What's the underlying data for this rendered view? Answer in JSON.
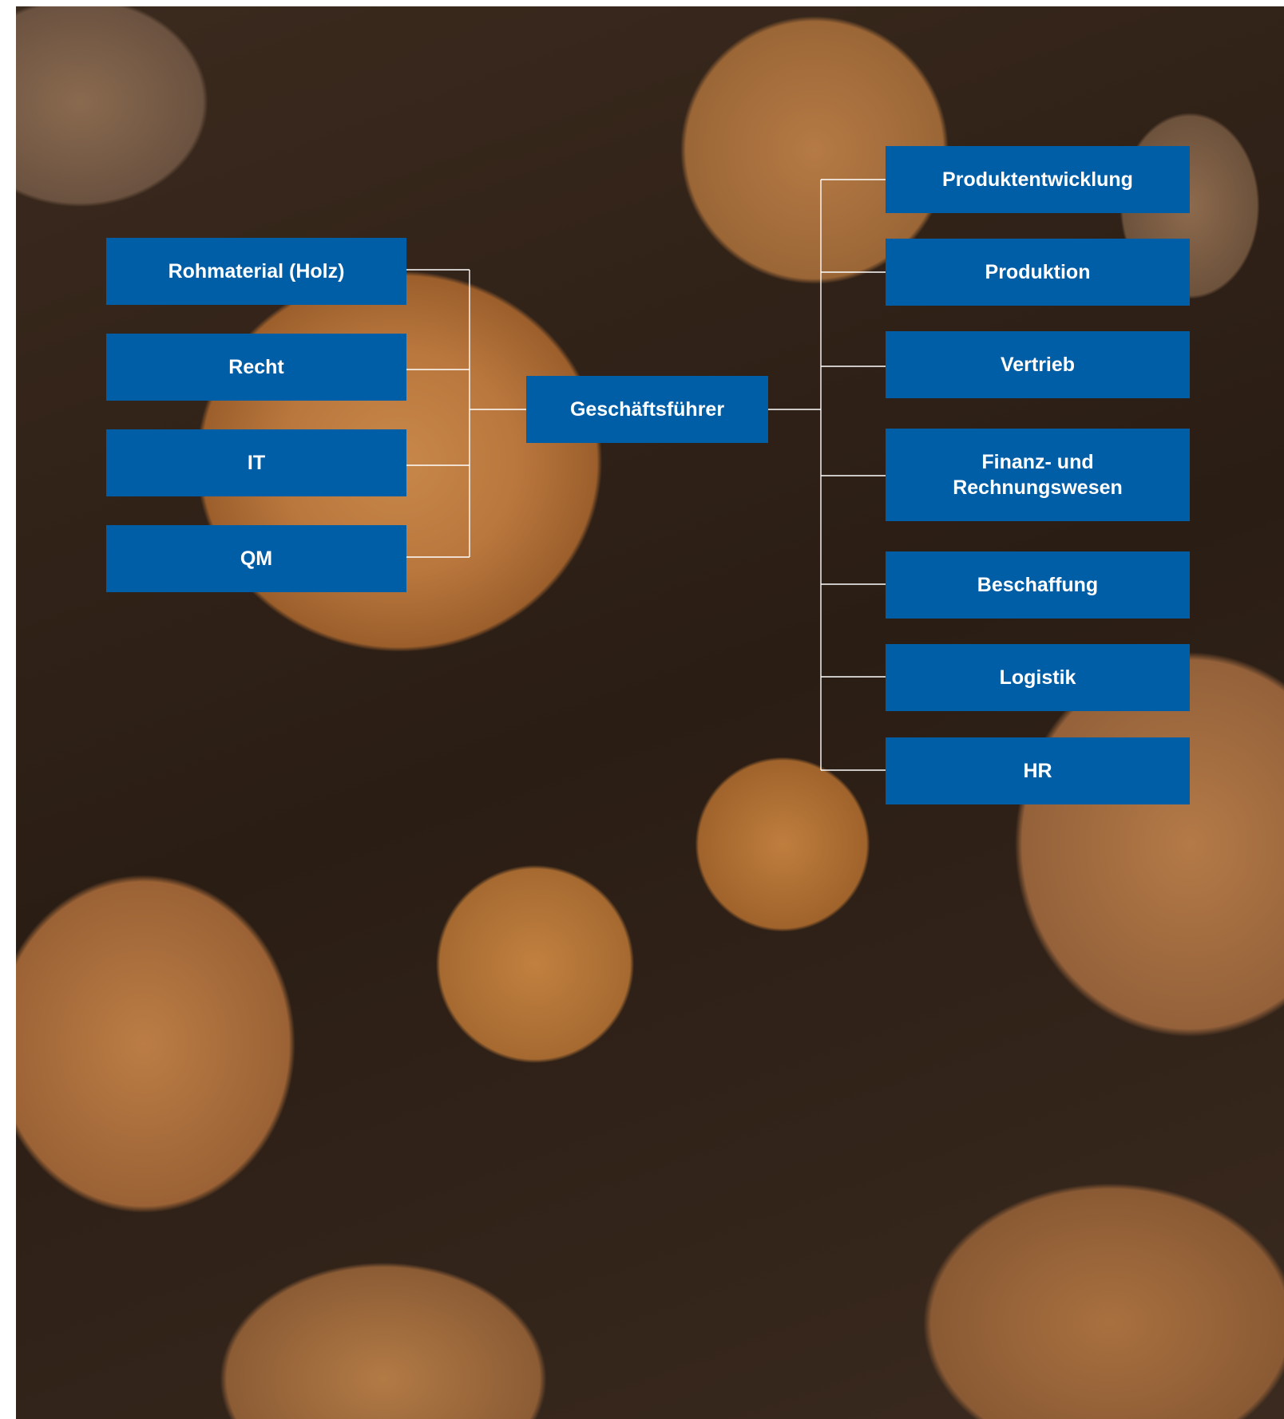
{
  "diagram": {
    "center": {
      "label": "Geschäftsführer"
    },
    "left_nodes": [
      {
        "label": "Rohmaterial (Holz)"
      },
      {
        "label": "Recht"
      },
      {
        "label": "IT"
      },
      {
        "label": "QM"
      }
    ],
    "right_nodes": [
      {
        "label": "Produktentwicklung"
      },
      {
        "label": "Produktion"
      },
      {
        "label": "Vertrieb"
      },
      {
        "label": "Finanz- und Rechnungswesen"
      },
      {
        "label": "Beschaffung"
      },
      {
        "label": "Logistik"
      },
      {
        "label": "HR"
      }
    ]
  },
  "colors": {
    "box_fill": "#005ea7",
    "box_text": "#ffffff",
    "connector": "#ffffff"
  },
  "background": {
    "description": "photo of stacked cut logs"
  }
}
